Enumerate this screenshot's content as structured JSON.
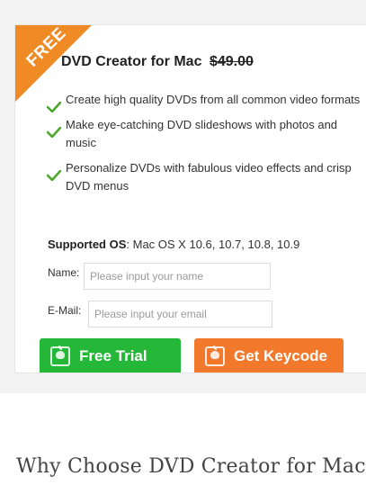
{
  "promo": {
    "ribbon_label": "FREE",
    "product_name": "DVD Creator for Mac",
    "old_price": "$49.00",
    "features": [
      "Create high quality DVDs from all common video formats",
      "Make eye-catching DVD slideshows with photos and music",
      "Personalize DVDs with fabulous video effects and crisp DVD menus"
    ],
    "os_label": "Supported OS",
    "os_value": ": Mac OS X 10.6, 10.7, 10.8, 10.9"
  },
  "form": {
    "name_label": "Name:",
    "name_placeholder": "Please input your name",
    "email_label": "E-Mail:",
    "email_placeholder": "Please input your email"
  },
  "buttons": {
    "trial_label": "Free Trial",
    "keycode_label": "Get Keycode"
  },
  "section_heading": "Why Choose DVD Creator for Mac",
  "colors": {
    "ribbon": "#f08a24",
    "trial_button": "#25b737",
    "keycode_button": "#f2792c",
    "check": "#4ca82c"
  },
  "icons": {
    "feature_bullet": "check-icon",
    "button_icon": "mac-finder-icon"
  }
}
